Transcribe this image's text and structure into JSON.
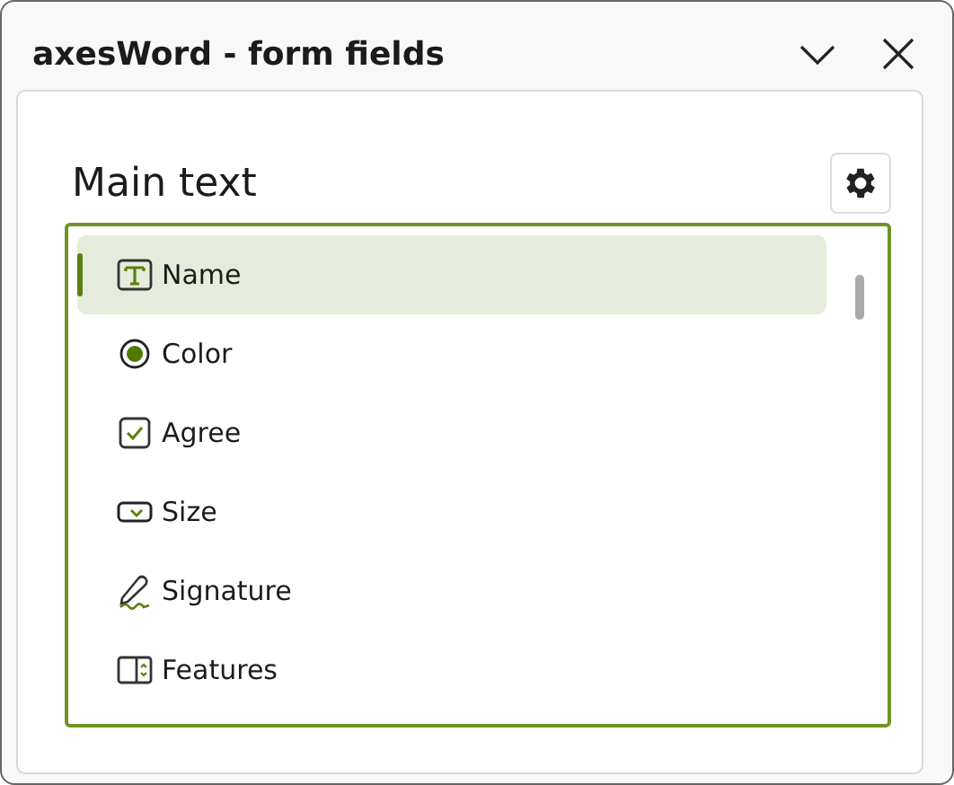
{
  "window": {
    "title": "axesWord - form fields"
  },
  "panel": {
    "heading": "Main text"
  },
  "fields": [
    {
      "kind": "text",
      "label": "Name",
      "selected": true
    },
    {
      "kind": "radio",
      "label": "Color",
      "selected": false
    },
    {
      "kind": "checkbox",
      "label": "Agree",
      "selected": false
    },
    {
      "kind": "dropdown",
      "label": "Size",
      "selected": false
    },
    {
      "kind": "signature",
      "label": "Signature",
      "selected": false
    },
    {
      "kind": "listbox",
      "label": "Features",
      "selected": false
    }
  ]
}
